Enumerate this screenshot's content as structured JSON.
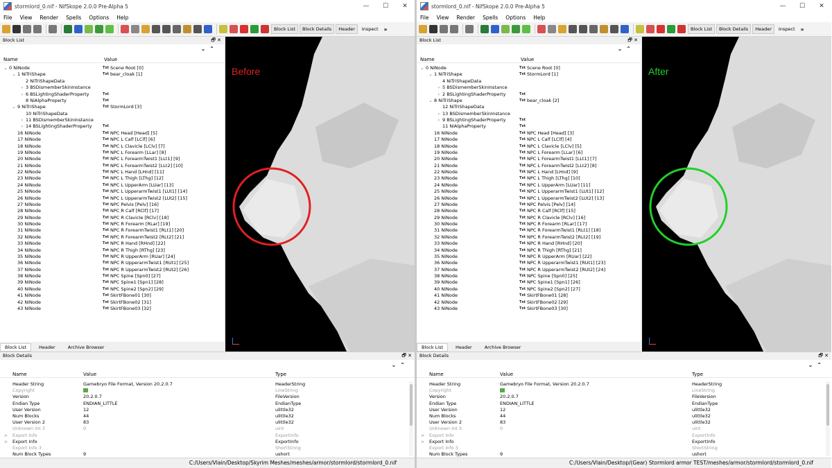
{
  "tree_rows": [
    [
      0,
      "0 NiNode",
      "Scene Root [0]"
    ],
    [
      1,
      "1 NiTriShape",
      "bear_cloak [1]"
    ],
    [
      2,
      "2 NiTriShapeData",
      ""
    ],
    [
      2,
      "3 BSDismemberSkinInstance",
      ""
    ],
    [
      2,
      "6 BSLightingShaderProperty",
      ""
    ],
    [
      2,
      "8 NiAlphaProperty",
      ""
    ],
    [
      1,
      "9 NiTriShape",
      "StormLord [3]"
    ],
    [
      2,
      "10 NiTriShapeData",
      ""
    ],
    [
      2,
      "11 BSDismemberSkinInstance",
      ""
    ],
    [
      2,
      "14 BSLightingShaderProperty",
      ""
    ],
    [
      1,
      "16 NiNode",
      "NPC Head [Head] [5]"
    ],
    [
      1,
      "17 NiNode",
      "NPC L Calf [LClf] [6]"
    ],
    [
      1,
      "18 NiNode",
      "NPC L Clavicle [LClv] [7]"
    ],
    [
      1,
      "19 NiNode",
      "NPC L Forearm [LLar] [8]"
    ],
    [
      1,
      "20 NiNode",
      "NPC L ForearmTwist1 [LLt1] [9]"
    ],
    [
      1,
      "21 NiNode",
      "NPC L ForearmTwist2 [LLt2] [10]"
    ],
    [
      1,
      "22 NiNode",
      "NPC L Hand [LHnd] [11]"
    ],
    [
      1,
      "23 NiNode",
      "NPC L Thigh [LThg] [12]"
    ],
    [
      1,
      "24 NiNode",
      "NPC L UpperArm [LUar] [13]"
    ],
    [
      1,
      "25 NiNode",
      "NPC L UpperarmTwist1 [LUt1] [14]"
    ],
    [
      1,
      "26 NiNode",
      "NPC L UpperarmTwist2 [LUt2] [15]"
    ],
    [
      1,
      "27 NiNode",
      "NPC Pelvis [Pelv] [16]"
    ],
    [
      1,
      "28 NiNode",
      "NPC R Calf [RClf] [17]"
    ],
    [
      1,
      "29 NiNode",
      "NPC R Clavicle [RClv] [18]"
    ],
    [
      1,
      "30 NiNode",
      "NPC R Forearm [RLar] [19]"
    ],
    [
      1,
      "31 NiNode",
      "NPC R ForearmTwist1 [RLt1] [20]"
    ],
    [
      1,
      "32 NiNode",
      "NPC R ForearmTwist2 [RLt2] [21]"
    ],
    [
      1,
      "33 NiNode",
      "NPC R Hand [RHnd] [22]"
    ],
    [
      1,
      "34 NiNode",
      "NPC R Thigh [RThg] [23]"
    ],
    [
      1,
      "35 NiNode",
      "NPC R UpperArm [RUar] [24]"
    ],
    [
      1,
      "36 NiNode",
      "NPC R UpperarmTwist1 [RUt1] [25]"
    ],
    [
      1,
      "37 NiNode",
      "NPC R UpperarmTwist2 [RUt2] [26]"
    ],
    [
      1,
      "38 NiNode",
      "NPC Spine [Spn0] [27]"
    ],
    [
      1,
      "39 NiNode",
      "NPC Spine1 [Spn1] [28]"
    ],
    [
      1,
      "40 NiNode",
      "NPC Spine2 [Spn2] [29]"
    ],
    [
      1,
      "41 NiNode",
      "SkirtFBone01 [30]"
    ],
    [
      1,
      "42 NiNode",
      "SkirtFBone02 [31]"
    ],
    [
      1,
      "43 NiNode",
      "SkirtFBone03 [32]"
    ]
  ],
  "windows": [
    {
      "title": "stormlord_0.nif - NifSkope 2.0.0 Pre-Alpha 5",
      "overlay_label": "Before",
      "overlay_color": "#e02020",
      "status_path": "C:/Users/Vlain/Desktop/Skyrim Meshes/meshes/armor/stormlord/stormlord_0.nif",
      "tree_rows": [
        [
          0,
          "0 NiNode",
          "Scene Root [0]"
        ],
        [
          1,
          "1 NiTriShape",
          "bear_cloak [1]"
        ],
        [
          2,
          "2 NiTriShapeData",
          ""
        ],
        [
          2,
          "3 BSDismemberSkinInstance",
          ""
        ],
        [
          2,
          "6 BSLightingShaderProperty",
          ""
        ],
        [
          2,
          "8 NiAlphaProperty",
          ""
        ],
        [
          1,
          "9 NiTriShape",
          "StormLord [3]"
        ],
        [
          2,
          "10 NiTriShapeData",
          ""
        ],
        [
          2,
          "11 BSDismemberSkinInstance",
          ""
        ],
        [
          2,
          "14 BSLightingShaderProperty",
          ""
        ],
        [
          1,
          "16 NiNode",
          "NPC Head [Head] [5]"
        ],
        [
          1,
          "17 NiNode",
          "NPC L Calf [LClf] [6]"
        ],
        [
          1,
          "18 NiNode",
          "NPC L Clavicle [LClv] [7]"
        ],
        [
          1,
          "19 NiNode",
          "NPC L Forearm [LLar] [8]"
        ],
        [
          1,
          "20 NiNode",
          "NPC L ForearmTwist1 [LLt1] [9]"
        ],
        [
          1,
          "21 NiNode",
          "NPC L ForearmTwist2 [LLt2] [10]"
        ],
        [
          1,
          "22 NiNode",
          "NPC L Hand [LHnd] [11]"
        ],
        [
          1,
          "23 NiNode",
          "NPC L Thigh [LThg] [12]"
        ],
        [
          1,
          "24 NiNode",
          "NPC L UpperArm [LUar] [13]"
        ],
        [
          1,
          "25 NiNode",
          "NPC L UpperarmTwist1 [LUt1] [14]"
        ],
        [
          1,
          "26 NiNode",
          "NPC L UpperarmTwist2 [LUt2] [15]"
        ],
        [
          1,
          "27 NiNode",
          "NPC Pelvis [Pelv] [16]"
        ],
        [
          1,
          "28 NiNode",
          "NPC R Calf [RClf] [17]"
        ],
        [
          1,
          "29 NiNode",
          "NPC R Clavicle [RClv] [18]"
        ],
        [
          1,
          "30 NiNode",
          "NPC R Forearm [RLar] [19]"
        ],
        [
          1,
          "31 NiNode",
          "NPC R ForearmTwist1 [RLt1] [20]"
        ],
        [
          1,
          "32 NiNode",
          "NPC R ForearmTwist2 [RLt2] [21]"
        ],
        [
          1,
          "33 NiNode",
          "NPC R Hand [RHnd] [22]"
        ],
        [
          1,
          "34 NiNode",
          "NPC R Thigh [RThg] [23]"
        ],
        [
          1,
          "35 NiNode",
          "NPC R UpperArm [RUar] [24]"
        ],
        [
          1,
          "36 NiNode",
          "NPC R UpperarmTwist1 [RUt1] [25]"
        ],
        [
          1,
          "37 NiNode",
          "NPC R UpperarmTwist2 [RUt2] [26]"
        ],
        [
          1,
          "38 NiNode",
          "NPC Spine [Spn0] [27]"
        ],
        [
          1,
          "39 NiNode",
          "NPC Spine1 [Spn1] [28]"
        ],
        [
          1,
          "40 NiNode",
          "NPC Spine2 [Spn2] [29]"
        ],
        [
          1,
          "41 NiNode",
          "SkirtFBone01 [30]"
        ],
        [
          1,
          "42 NiNode",
          "SkirtFBone02 [31]"
        ],
        [
          1,
          "43 NiNode",
          "SkirtFBone03 [32]"
        ]
      ]
    },
    {
      "title": "stormlord_0.nif - NifSkope 2.0.0 Pre-Alpha 5",
      "overlay_label": "After",
      "overlay_color": "#1fd02a",
      "status_path": "C:/Users/Vlain/Desktop/(Gear) Stormlord armor TEST/meshes/armor/stormlord/stormlord_0.nif",
      "tree_rows": [
        [
          0,
          "0 NiNode",
          "Scene Root [0]"
        ],
        [
          1,
          "1 NiTriShape",
          "StormLord [1]"
        ],
        [
          2,
          "4 NiTriShapeData",
          ""
        ],
        [
          2,
          "5 BSDismemberSkinInstance",
          ""
        ],
        [
          2,
          "2 BSLightingShaderProperty",
          ""
        ],
        [
          1,
          "8 NiTriShape",
          "bear_cloak [2]"
        ],
        [
          2,
          "12 NiTriShapeData",
          ""
        ],
        [
          2,
          "13 BSDismemberSkinInstance",
          ""
        ],
        [
          2,
          "9 BSLightingShaderProperty",
          ""
        ],
        [
          2,
          "11 NiAlphaProperty",
          ""
        ],
        [
          1,
          "16 NiNode",
          "NPC Head [Head] [3]"
        ],
        [
          1,
          "17 NiNode",
          "NPC L Calf [LClf] [4]"
        ],
        [
          1,
          "18 NiNode",
          "NPC L Clavicle [LClv] [5]"
        ],
        [
          1,
          "19 NiNode",
          "NPC L Forearm [LLar] [6]"
        ],
        [
          1,
          "20 NiNode",
          "NPC L ForearmTwist1 [LLt1] [7]"
        ],
        [
          1,
          "21 NiNode",
          "NPC L ForearmTwist2 [LLt2] [8]"
        ],
        [
          1,
          "22 NiNode",
          "NPC L Hand [LHnd] [9]"
        ],
        [
          1,
          "23 NiNode",
          "NPC L Thigh [LThg] [10]"
        ],
        [
          1,
          "24 NiNode",
          "NPC L UpperArm [LUar] [11]"
        ],
        [
          1,
          "25 NiNode",
          "NPC L UpperarmTwist1 [LUt1] [12]"
        ],
        [
          1,
          "26 NiNode",
          "NPC L UpperarmTwist2 [LUt2] [13]"
        ],
        [
          1,
          "27 NiNode",
          "NPC Pelvis [Pelv] [14]"
        ],
        [
          1,
          "28 NiNode",
          "NPC R Calf [RClf] [15]"
        ],
        [
          1,
          "29 NiNode",
          "NPC R Clavicle [RClv] [16]"
        ],
        [
          1,
          "30 NiNode",
          "NPC R Forearm [RLar] [17]"
        ],
        [
          1,
          "31 NiNode",
          "NPC R ForearmTwist1 [RLt1] [18]"
        ],
        [
          1,
          "32 NiNode",
          "NPC R ForearmTwist2 [RLt2] [19]"
        ],
        [
          1,
          "33 NiNode",
          "NPC R Hand [RHnd] [20]"
        ],
        [
          1,
          "34 NiNode",
          "NPC R Thigh [RThg] [21]"
        ],
        [
          1,
          "35 NiNode",
          "NPC R UpperArm [RUar] [22]"
        ],
        [
          1,
          "36 NiNode",
          "NPC R UpperarmTwist1 [RUt1] [23]"
        ],
        [
          1,
          "37 NiNode",
          "NPC R UpperarmTwist2 [RUt2] [24]"
        ],
        [
          1,
          "38 NiNode",
          "NPC Spine [Spn0] [25]"
        ],
        [
          1,
          "39 NiNode",
          "NPC Spine1 [Spn1] [26]"
        ],
        [
          1,
          "40 NiNode",
          "NPC Spine2 [Spn2] [27]"
        ],
        [
          1,
          "41 NiNode",
          "SkirtFBone01 [28]"
        ],
        [
          1,
          "42 NiNode",
          "SkirtFBone02 [29]"
        ],
        [
          1,
          "43 NiNode",
          "SkirtFBone03 [30]"
        ]
      ]
    }
  ],
  "menus": [
    "File",
    "View",
    "Render",
    "Spells",
    "Options",
    "Help"
  ],
  "toolbar_tabs": [
    "Block List",
    "Block Details",
    "Header",
    "Inspect"
  ],
  "toolbar_more": "»",
  "window_buttons": [
    "—",
    "☐",
    "✕"
  ],
  "block_list": {
    "title": "Block List",
    "col_name": "Name",
    "col_value": "Value",
    "txt_badge": "Txt",
    "controls": "🗗 ✕",
    "arrows": "⌄⌃"
  },
  "bottom_tabs": [
    "Block List",
    "Header",
    "Archive Browser"
  ],
  "block_details": {
    "title": "Block Details",
    "col_name": "Name",
    "col_value": "Value",
    "col_type": "Type",
    "controls": "🗗 ✕",
    "arrows": "⌄⌃",
    "rows": [
      {
        "expand": "",
        "name": "Header String",
        "value": "Gamebryo File Format, Version 20.2.0.7",
        "type": "HeaderString",
        "dim": false
      },
      {
        "expand": "",
        "name": "Copyright",
        "value": "",
        "type": "LineString",
        "dim": true
      },
      {
        "expand": "",
        "name": "Version",
        "value": "20.2.0.7",
        "type": "FileVersion",
        "dim": false
      },
      {
        "expand": "",
        "name": "Endian Type",
        "value": "ENDIAN_LITTLE",
        "type": "EndianType",
        "dim": false
      },
      {
        "expand": "",
        "name": "User Version",
        "value": "12",
        "type": "ulittle32",
        "dim": false
      },
      {
        "expand": "",
        "name": "Num Blocks",
        "value": "44",
        "type": "ulittle32",
        "dim": false
      },
      {
        "expand": "",
        "name": "User Version 2",
        "value": "83",
        "type": "ulittle32",
        "dim": false
      },
      {
        "expand": "",
        "name": "Unknown Int 3",
        "value": "0",
        "type": "uint",
        "dim": true
      },
      {
        "expand": ">",
        "name": "Export Info",
        "value": "",
        "type": "ExportInfo",
        "dim": true
      },
      {
        "expand": ">",
        "name": "Export Info",
        "value": "",
        "type": "ExportInfo",
        "dim": false
      },
      {
        "expand": "",
        "name": "Export Info 3",
        "value": "",
        "type": "ShortString",
        "dim": true
      },
      {
        "expand": "",
        "name": "Num Block Types",
        "value": "9",
        "type": "ushort",
        "dim": false
      }
    ]
  },
  "colors": {
    "viewport_bg": "#000000",
    "mesh": "#d9d9d9"
  }
}
